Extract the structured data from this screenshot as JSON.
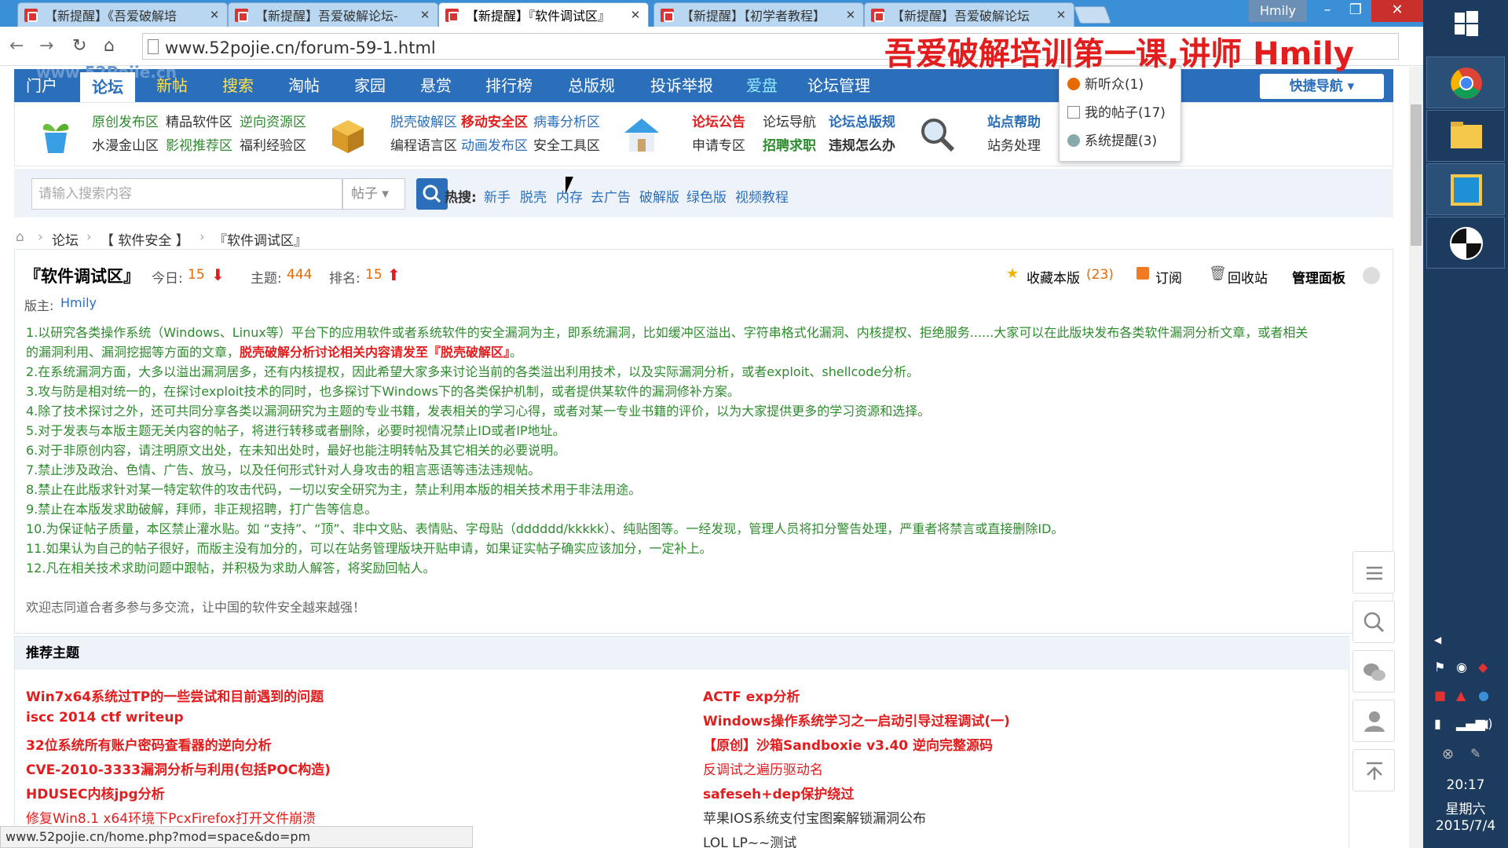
{
  "browser": {
    "tabs": [
      {
        "title": "【新提醒】《吾爱破解培"
      },
      {
        "title": "【新提醒】吾爱破解论坛-"
      },
      {
        "title": "【新提醒】『软件调试区』"
      },
      {
        "title": "【新提醒】【初学者教程】"
      },
      {
        "title": "【新提醒】吾爱破解论坛"
      }
    ],
    "user": "Hmily",
    "url": "www.52pojie.cn/forum-59-1.html",
    "status_url": "www.52pojie.cn/home.php?mod=space&do=pm"
  },
  "overlay_title": "吾爱破解培训第一课,讲师 Hmily",
  "site": {
    "watermark": "www.52Pojie.cn",
    "nav": [
      "门户",
      "论坛",
      "新帖",
      "搜索",
      "淘帖",
      "家园",
      "悬赏",
      "排行榜",
      "总版规",
      "投诉举报",
      "爱盘",
      "论坛管理"
    ],
    "quick_nav": "快捷导航",
    "subnav": {
      "g1": [
        "原创发布区",
        "精品软件区",
        "逆向资源区",
        "水漫金山区",
        "影视推荐区",
        "福利经验区"
      ],
      "g2": [
        "脱壳破解区",
        "移动安全区",
        "病毒分析区",
        "编程语言区",
        "动画发布区",
        "安全工具区"
      ],
      "g3": [
        "论坛公告",
        "论坛导航",
        "论坛总版规",
        "申请专区",
        "招聘求职",
        "违规怎么办"
      ],
      "g4": [
        "站点帮助",
        "站务处理"
      ]
    },
    "dropdown": [
      "新听众(1)",
      "我的帖子(17)",
      "系统提醒(3)"
    ],
    "search": {
      "placeholder": "请输入搜索内容",
      "type": "帖子",
      "hot_label": "热搜:",
      "hot": [
        "新手",
        "脱壳",
        "内存",
        "去广告",
        "破解版",
        "绿色版",
        "视频教程"
      ]
    },
    "breadcrumb": [
      "论坛",
      "【 软件安全 】",
      "『软件调试区』"
    ]
  },
  "forum": {
    "name": "『软件调试区』",
    "today_label": "今日:",
    "today": "15",
    "topics_label": "主题:",
    "topics": "444",
    "rank_label": "排名:",
    "rank": "15",
    "favorite": "收藏本版",
    "favorite_count": "(23)",
    "subscribe": "订阅",
    "recycle": "回收站",
    "admin": "管理面板",
    "moderator_label": "版主:",
    "moderator": "Hmily",
    "rules": [
      "1.以研究各类操作系统（Windows、Linux等）平台下的应用软件或者系统软件的安全漏洞为主，即系统漏洞，比如缓冲区溢出、字符串格式化漏洞、内核提权、拒绝服务......大家可以在此版块发布各类软件漏洞分析文章，或者相关",
      "的漏洞利用、漏洞挖掘等方面的文章，",
      "2.在系统漏洞方面，大多以溢出漏洞居多，还有内核提权，因此希望大家多来讨论当前的各类溢出利用技术，以及实际漏洞分析，或者exploit、shellcode分析。",
      "3.攻与防是相对统一的，在探讨exploit技术的同时，也多探讨下Windows下的各类保护机制，或者提供某软件的漏洞修补方案。",
      "4.除了技术探讨之外，还可共同分享各类以漏洞研究为主题的专业书籍，发表相关的学习心得，或者对某一专业书籍的评价，以为大家提供更多的学习资源和选择。",
      "5.对于发表与本版主题无关内容的帖子，将进行转移或者删除，必要时视情况禁止ID或者IP地址。",
      "6.对于非原创内容，请注明原文出处，在未知出处时，最好也能注明转帖及其它相关的必要说明。",
      "7.禁止涉及政治、色情、广告、放马，以及任何形式针对人身攻击的粗言恶语等违法违规帖。",
      "8.禁止在此版求针对某一特定软件的攻击代码，一切以安全研究为主，禁止利用本版的相关技术用于非法用途。",
      "9.禁止在本版发求助破解，拜师，非正规招聘，打广告等信息。",
      "10.为保证帖子质量，本区禁止灌水贴。如 “支持”、“顶”、非中文贴、表情贴、字母贴（dddddd/kkkkk）、纯贴图等。一经发现，管理人员将扣分警告处理，严重者将禁言或直接删除ID。",
      "11.如果认为自己的帖子很好，而版主没有加分的，可以在站务管理版块开贴申请，如果证实帖子确实应该加分，一定补上。",
      "12.凡在相关技术求助问题中跟帖，并积极为求助人解答，将奖励回帖人。"
    ],
    "rule_link": "脱壳破解分析讨论相关内容请发至『脱壳破解区』",
    "rule_end": "。",
    "welcome": "欢迎志同道合者多参与多交流，让中国的软件安全越来越强！"
  },
  "recommend": {
    "title": "推荐主题",
    "left": [
      "Win7x64系统过TP的一些尝试和目前遇到的问题",
      "iscc 2014 ctf writeup",
      "32位系统所有账户密码查看器的逆向分析",
      "CVE-2010-3333漏洞分析与利用(包括POC构造)",
      "HDUSEC内核jpg分析",
      "修复Win8.1 x64环境下PcxFirefox打开文件崩溃"
    ],
    "right": [
      "ACTF exp分析",
      "Windows操作系统学习之一启动引导过程调试(一)",
      "【原创】沙箱Sandboxie v3.40 逆向完整源码",
      "反调试之遍历驱动名",
      "safeseh+dep保护绕过",
      "苹果IOS系统支付宝图案解锁漏洞公布",
      "LOL LP~~测试"
    ]
  },
  "taskbar": {
    "time": "20:17",
    "weekday": "星期六",
    "date": "2015/7/4"
  },
  "colors": {
    "brand_blue": "#2b6fbb",
    "rule_green": "#2e8b2e",
    "hot_red": "#e21d1d",
    "taskbar": "#1d3b5e"
  }
}
